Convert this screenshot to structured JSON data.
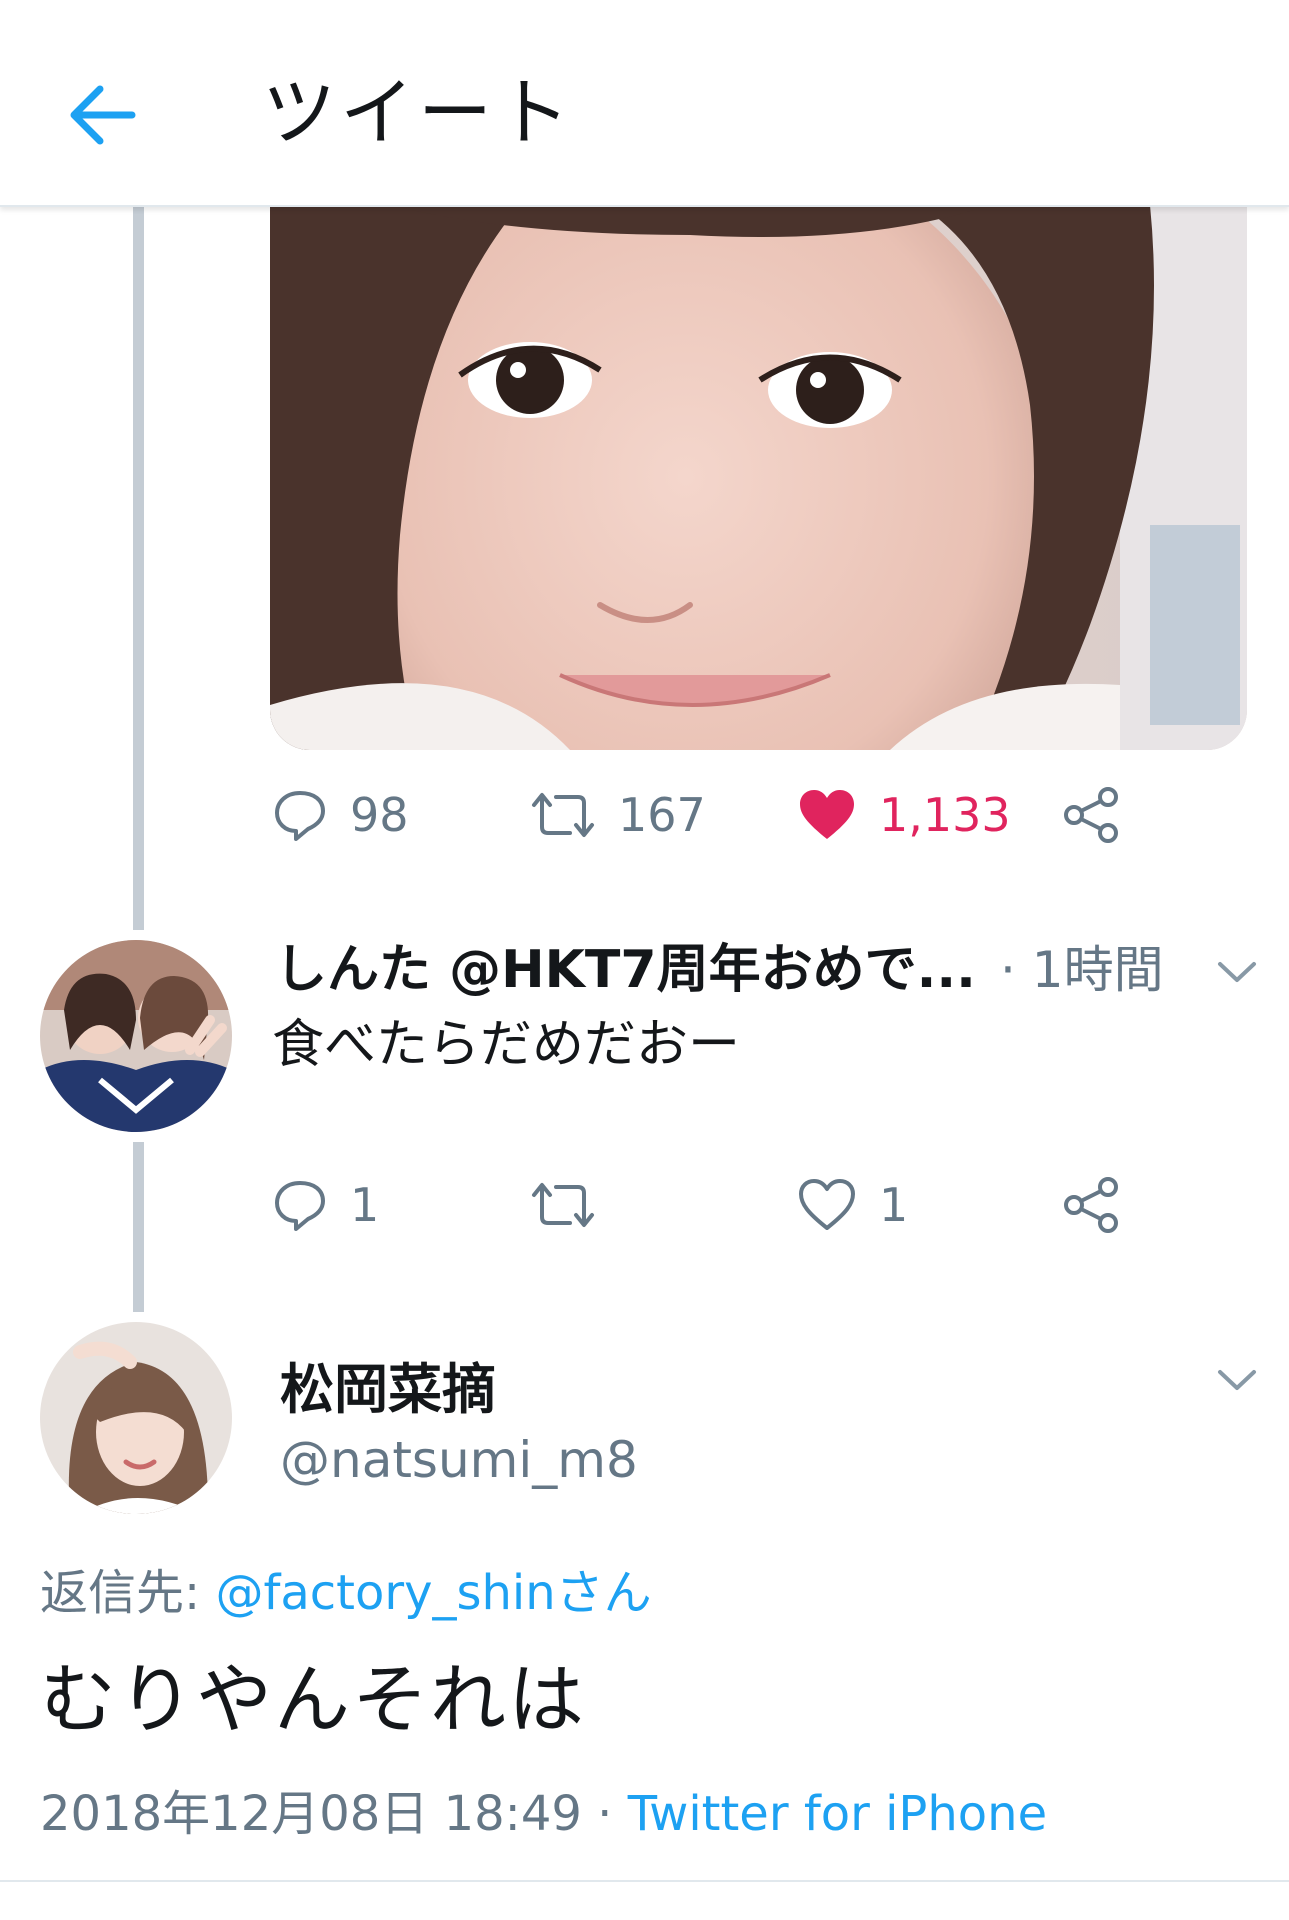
{
  "header": {
    "title": "ツイート"
  },
  "colors": {
    "accent": "#1da1f2",
    "like": "#e0245e",
    "secondary_text": "#657786",
    "thread_line": "#c4ccd4"
  },
  "icons": [
    "back-arrow-icon",
    "reply-icon",
    "retweet-icon",
    "heart-icon",
    "share-icon",
    "chevron-down-icon"
  ],
  "previous_tweet": {
    "stats": {
      "replies": "98",
      "retweets": "167",
      "likes": "1,133",
      "liked": true
    }
  },
  "reply_tweet": {
    "name_handle": "しんた @HKT7周年おめで...",
    "time": "· 1時間",
    "text": "食べたらだめだおー",
    "stats": {
      "replies": "1",
      "retweets": "",
      "likes": "1",
      "liked": false
    }
  },
  "main_tweet": {
    "display_name": "松岡菜摘",
    "handle": "@natsumi_m8",
    "reply_to_label": "返信先: ",
    "reply_to_mention": "@factory_shinさん",
    "text": "むりやんそれは",
    "datetime": "2018年12月08日 18:49 · ",
    "client": "Twitter for iPhone"
  }
}
